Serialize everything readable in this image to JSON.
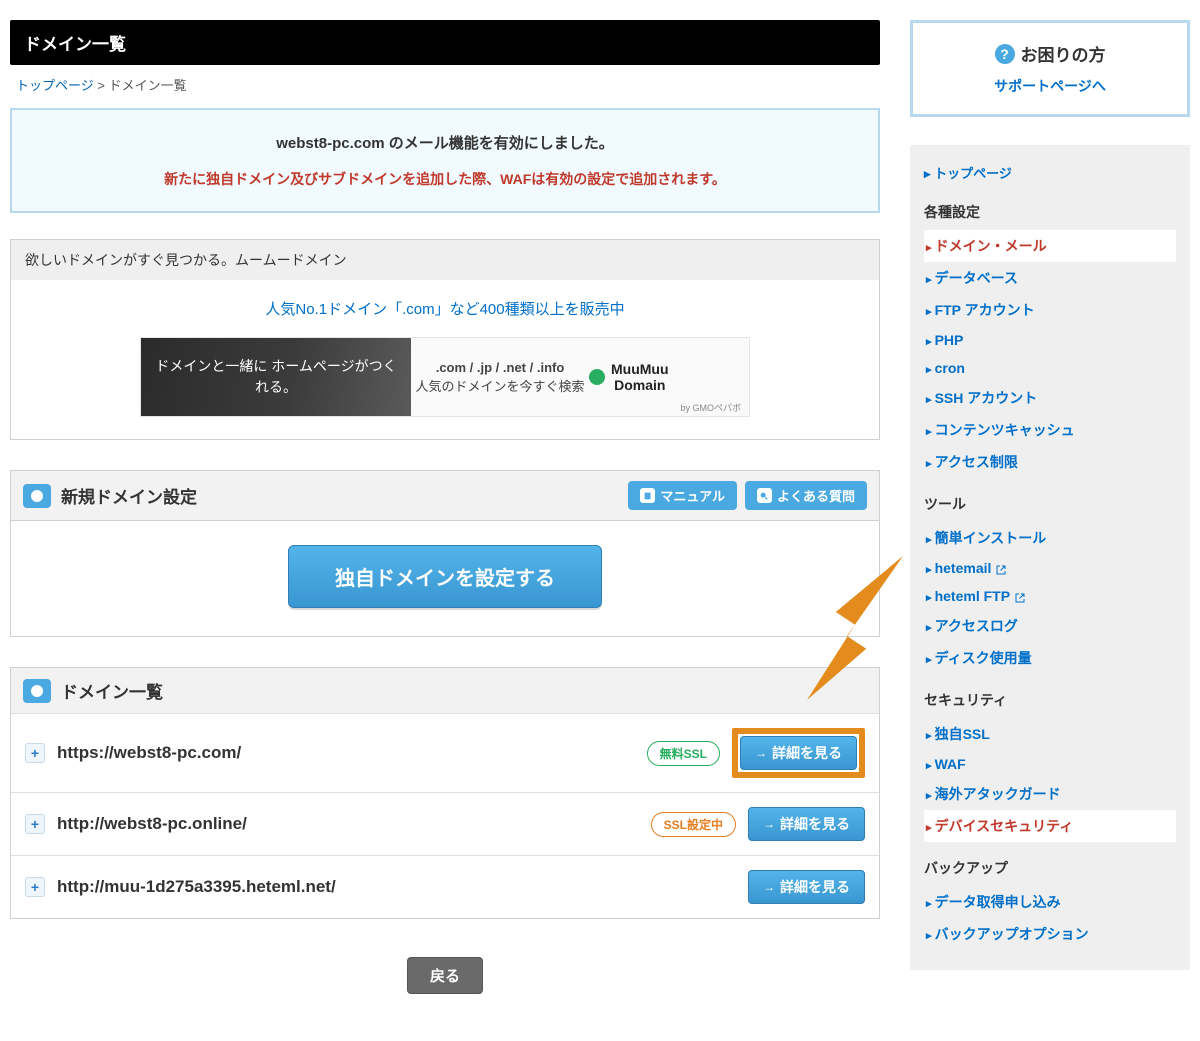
{
  "page_title": "ドメイン一覧",
  "breadcrumb": {
    "top": "トップページ",
    "sep": " > ",
    "current": "ドメイン一覧"
  },
  "infobox": {
    "line1": "webst8-pc.com のメール機能を有効にしました。",
    "line2": "新たに独自ドメイン及びサブドメインを追加した際、WAFは有効の設定で追加されます。"
  },
  "promo": {
    "head": "欲しいドメインがすぐ見つかる。ムームードメイン",
    "link": "人気No.1ドメイン「.com」など400種類以上を販売中",
    "banner_left": "ドメインと一緒に\nホームページがつくれる。",
    "banner_mid_t1": ".com / .jp / .net / .info",
    "banner_mid_t2": "人気のドメインを今すぐ検索",
    "banner_right": "MuuMuu\nDomain",
    "banner_sub": "by GMOペパボ"
  },
  "section_new": {
    "title": "新規ドメイン設定",
    "manual": "マニュアル",
    "faq": "よくある質問",
    "cta": "独自ドメインを設定する"
  },
  "section_list": {
    "title": "ドメイン一覧",
    "detail_label": "詳細を見る",
    "ssl_free": "無料SSL",
    "ssl_progress": "SSL設定中",
    "domains": [
      {
        "url": "https://webst8-pc.com/",
        "ssl": "free",
        "highlight": true
      },
      {
        "url": "http://webst8-pc.online/",
        "ssl": "progress",
        "highlight": false
      },
      {
        "url": "http://muu-1d275a3395.heteml.net/",
        "ssl": null,
        "highlight": false
      }
    ],
    "back": "戻る"
  },
  "side": {
    "help_title": "お困りの方",
    "help_link": "サポートページへ",
    "top_link": "トップページ",
    "groups": [
      {
        "title": "各種設定",
        "items": [
          {
            "label": "ドメイン・メール",
            "active": true
          },
          {
            "label": "データベース"
          },
          {
            "label": "FTP アカウント"
          },
          {
            "label": "PHP"
          },
          {
            "label": "cron"
          },
          {
            "label": "SSH アカウント"
          },
          {
            "label": "コンテンツキャッシュ"
          },
          {
            "label": "アクセス制限"
          }
        ]
      },
      {
        "title": "ツール",
        "items": [
          {
            "label": "簡単インストール"
          },
          {
            "label": "hetemail",
            "ext": true
          },
          {
            "label": "heteml FTP",
            "ext": true
          },
          {
            "label": "アクセスログ"
          },
          {
            "label": "ディスク使用量"
          }
        ]
      },
      {
        "title": "セキュリティ",
        "items": [
          {
            "label": "独自SSL"
          },
          {
            "label": "WAF"
          },
          {
            "label": "海外アタックガード"
          },
          {
            "label": "デバイスセキュリティ",
            "active": true
          }
        ]
      },
      {
        "title": "バックアップ",
        "items": [
          {
            "label": "データ取得申し込み"
          },
          {
            "label": "バックアップオプション"
          }
        ]
      }
    ]
  }
}
